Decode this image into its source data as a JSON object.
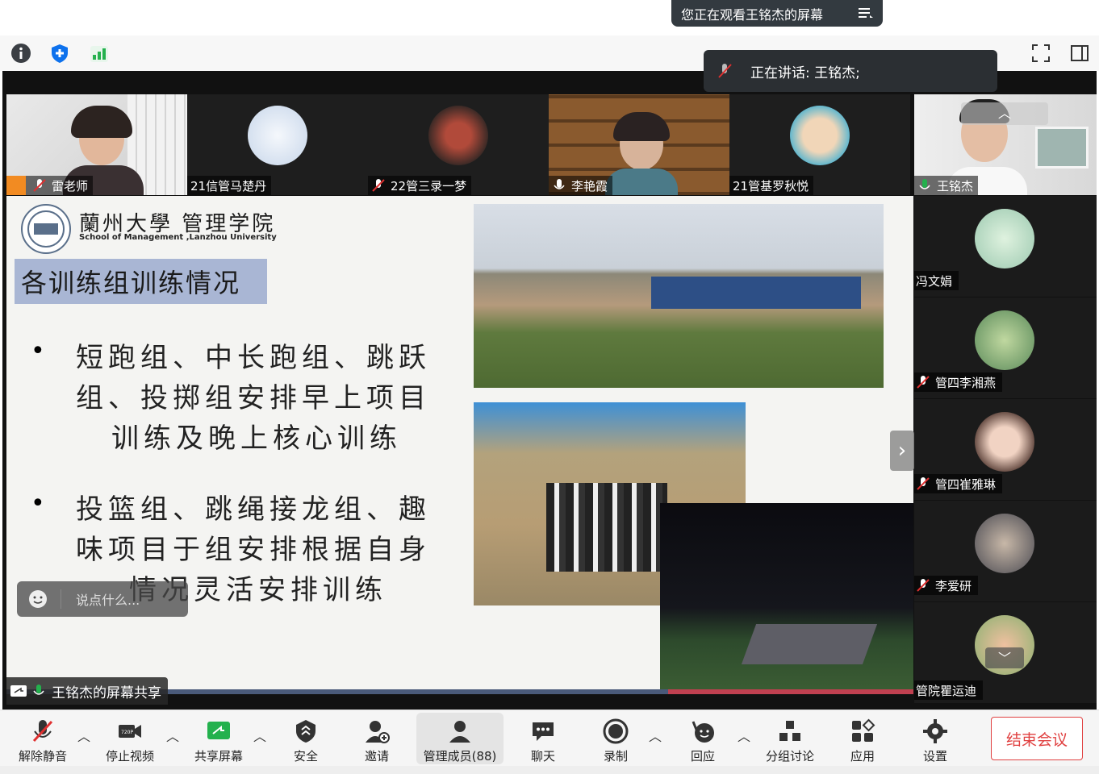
{
  "banner": {
    "text": "您正在观看王铭杰的屏幕"
  },
  "speaking": {
    "text": "正在讲话: 王铭杰;"
  },
  "tiles": [
    {
      "name": "雷老师"
    },
    {
      "name": "21信管马楚丹"
    },
    {
      "name": "22管三录一梦"
    },
    {
      "name": "李艳霞"
    },
    {
      "name": "21管基罗秋悦"
    },
    {
      "name": "王铭杰"
    }
  ],
  "side": [
    {
      "name": "冯文娟"
    },
    {
      "name": "管四李湘燕"
    },
    {
      "name": "管四崔雅琳"
    },
    {
      "name": "李爱研"
    },
    {
      "name": "管院瞿运迪"
    }
  ],
  "slide": {
    "logo_text": "蘭州大學 管理学院",
    "logo_sub": "School of Management ,Lanzhou University",
    "title": "各训练组训练情况",
    "bullet1": [
      "短跑组、中长跑组、跳跃",
      "组、投掷组安排早上项目",
      "训练及晚上核心训练"
    ],
    "bullet2": [
      "投篮组、跳绳接龙组、趣",
      "味项目于组安排根据自身",
      "情况灵活安排训练"
    ]
  },
  "chat_pill": {
    "placeholder": "说点什么..."
  },
  "share_label": "王铭杰的屏幕共享",
  "toolbar": {
    "unmute": "解除静音",
    "stop_video": "停止视频",
    "share": "共享屏幕",
    "security": "安全",
    "invite": "邀请",
    "participants": "管理成员(88)",
    "chat": "聊天",
    "record": "录制",
    "reactions": "回应",
    "breakout": "分组讨论",
    "apps": "应用",
    "settings": "设置",
    "end": "结束会议"
  },
  "colors": {
    "end": "#e04040",
    "accent": "#0e72ed",
    "signal": "#23b14d"
  }
}
